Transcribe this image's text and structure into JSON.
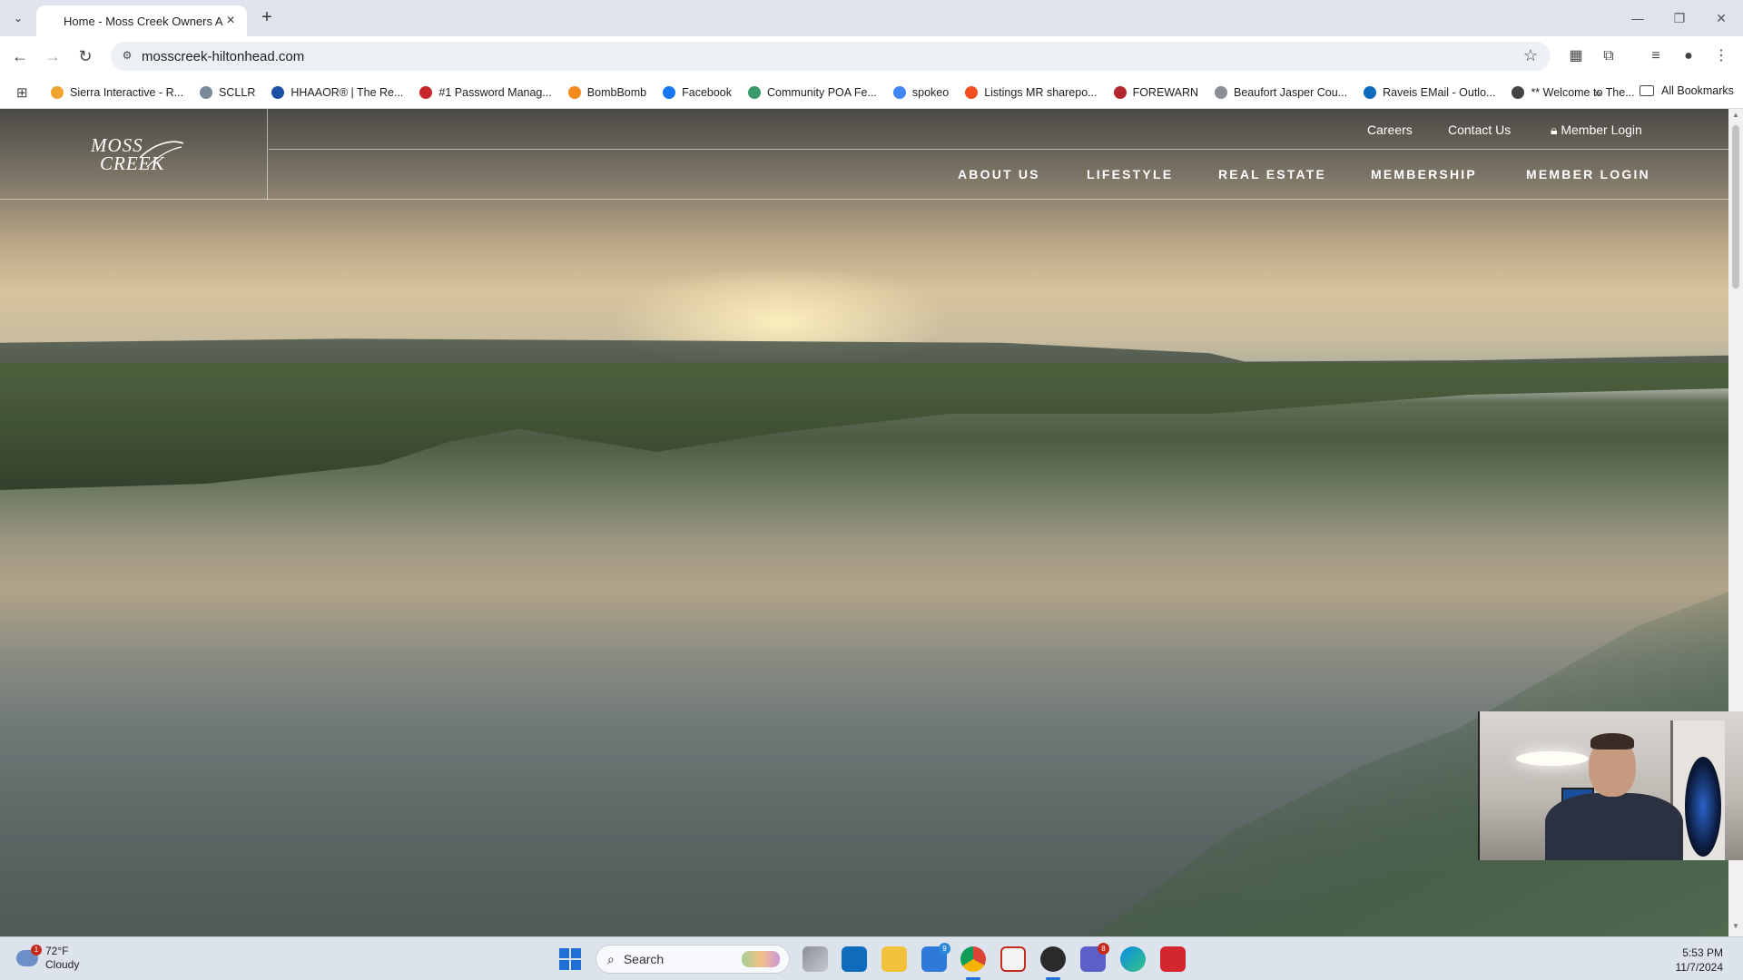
{
  "browser": {
    "tab_title": "Home - Moss Creek Owners As",
    "url": "mosscreek-hiltonhead.com",
    "bookmarks": [
      {
        "label": "Sierra Interactive - R...",
        "color": "#f0a22e"
      },
      {
        "label": "SCLLR",
        "color": "#7a8a99"
      },
      {
        "label": "HHAAOR® | The Re...",
        "color": "#1b4fa8"
      },
      {
        "label": "#1 Password Manag...",
        "color": "#c8252c"
      },
      {
        "label": "BombBomb",
        "color": "#f28a1e"
      },
      {
        "label": "Facebook",
        "color": "#1877f2"
      },
      {
        "label": "Community POA Fe...",
        "color": "#3a9a6b"
      },
      {
        "label": "spokeo",
        "color": "#4285f4"
      },
      {
        "label": "Listings MR sharepo...",
        "color": "#f25022"
      },
      {
        "label": "FOREWARN",
        "color": "#b3262d"
      },
      {
        "label": "Beaufort Jasper Cou...",
        "color": "#8a8f96"
      },
      {
        "label": "Raveis EMail - Outlo...",
        "color": "#0f6cbd"
      },
      {
        "label": "** Welcome to The...",
        "color": "#444444"
      }
    ],
    "all_bookmarks": "All Bookmarks"
  },
  "site": {
    "logo_top": "MOSS",
    "logo_bottom": "CREEK",
    "utility_links": {
      "careers": "Careers",
      "contact": "Contact Us",
      "member_login": "Member Login"
    },
    "nav": {
      "about": "ABOUT US",
      "lifestyle": "LIFESTYLE",
      "real_estate": "REAL ESTATE",
      "membership": "MEMBERSHIP",
      "member_login": "MEMBER LOGIN"
    }
  },
  "taskbar": {
    "weather_temp": "72°F",
    "weather_desc": "Cloudy",
    "weather_badge": "1",
    "search_placeholder": "Search",
    "phone_badge": "9",
    "teams_badge": "8",
    "time": "5:53 PM",
    "date": "11/7/2024"
  }
}
